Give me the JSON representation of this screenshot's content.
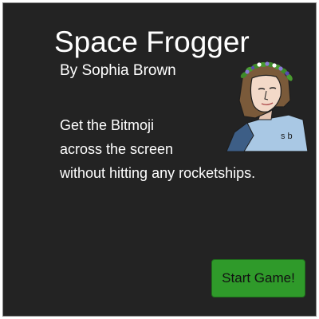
{
  "game": {
    "title": "Space Frogger",
    "author": "By Sophia Brown",
    "instructions": [
      "Get the Bitmoji",
      "across the screen",
      "without hitting any rocketships."
    ],
    "start_button_label": "Start Game!"
  },
  "avatar": {
    "icon": "bitmoji-avatar-with-flower-crown",
    "shirt_initials": "s b"
  },
  "colors": {
    "background": "#232323",
    "text": "#ffffff",
    "start_button": "#2f9a2a",
    "shirt": "#a9c8e4",
    "hair": "#7a5a3a",
    "skin": "#f3d9c8",
    "leaves": "#3f8a2a",
    "flowers": "#8a7ad6"
  }
}
